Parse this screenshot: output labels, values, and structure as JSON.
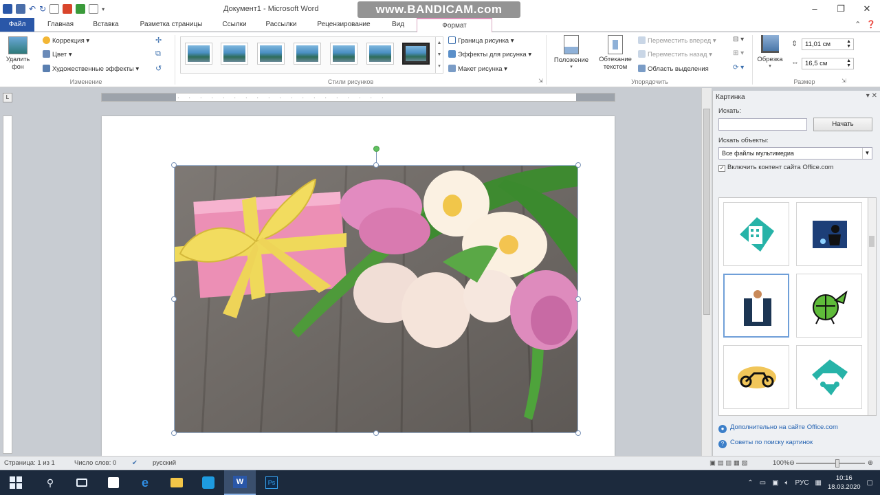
{
  "window": {
    "title": "Документ1 - Microsoft Word",
    "watermark": "www.BANDICAM.com",
    "controls": {
      "minimize": "–",
      "maximize": "❐",
      "close": "✕"
    }
  },
  "tabs": {
    "file": "Файл",
    "home": "Главная",
    "insert": "Вставка",
    "layout": "Разметка страницы",
    "references": "Ссылки",
    "mailings": "Рассылки",
    "review": "Рецензирование",
    "view": "Вид",
    "format": "Формат"
  },
  "ribbon": {
    "remove_bg": "Удалить фон",
    "correction": "Коррекция",
    "color": "Цвет",
    "artistic": "Художественные эффекты",
    "group_change": "Изменение",
    "group_styles": "Стили рисунков",
    "border": "Граница рисунка",
    "effects": "Эффекты для рисунка",
    "layout": "Макет рисунка",
    "position": "Положение",
    "wrap": "Обтекание текстом",
    "bring_forward": "Переместить вперед",
    "send_backward": "Переместить назад",
    "selection_pane": "Область выделения",
    "group_arrange": "Упорядочить",
    "crop": "Обрезка",
    "height": "11,01 см",
    "width": "16,5 см",
    "group_size": "Размер"
  },
  "pane": {
    "title": "Картинка",
    "search_label": "Искать:",
    "search_value": "",
    "search_button": "Начать",
    "objects_label": "Искать объекты:",
    "objects_value": "Все файлы мультимедиа",
    "include_office": "Включить контент сайта Office.com",
    "more_link": "Дополнительно на сайте Office.com",
    "tips_link": "Советы по поиску картинок"
  },
  "status": {
    "page": "Страница: 1 из 1",
    "words": "Число слов: 0",
    "language": "русский",
    "zoom": "100%"
  },
  "taskbar": {
    "lang": "РУС",
    "time": "10:16",
    "date": "18.03.2020"
  },
  "colors": {
    "file_tab": "#2a57a8",
    "context_accent": "#e87fb7",
    "taskbar": "#1c2a3d"
  }
}
